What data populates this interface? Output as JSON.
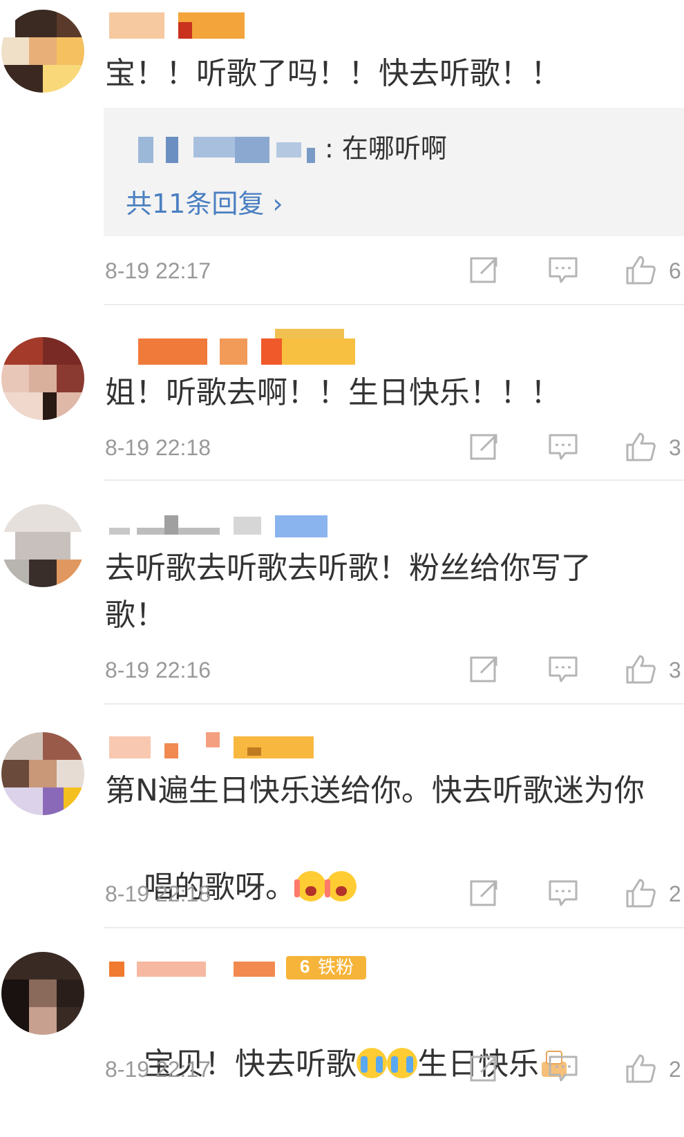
{
  "comments": [
    {
      "text": "宝！！听歌了吗！！快去听歌！！",
      "time": "8-19 22:17",
      "likes": "6",
      "reply": {
        "text": ": 在哪听啊",
        "count_label": "共11条回复 ›"
      }
    },
    {
      "text": "姐！听歌去啊！！生日快乐！！！",
      "time": "8-19 22:18",
      "likes": "3"
    },
    {
      "text_line1": "去听歌去听歌去听歌！粉丝给你写了",
      "text_line2": "歌！",
      "time": "8-19 22:16",
      "likes": "3"
    },
    {
      "text_line1": "第N遍生日快乐送给你。快去听歌迷为你",
      "text_line2": "唱的歌呀。",
      "time": "8-19 22:18",
      "likes": "2"
    },
    {
      "text_a": "宝贝！快去听歌",
      "text_b": "生日快乐",
      "badge": "铁粉",
      "badge_level": "6",
      "time": "8-19 22:17",
      "likes": "2"
    }
  ],
  "icons": {
    "share": "share-icon",
    "comment": "comment-icon",
    "like": "like-icon",
    "emoji_cry": "crying-emoji",
    "emoji_angry": "screaming-emoji",
    "emoji_cake": "birthday-cake-emoji"
  },
  "colors": {
    "link": "#4a7fc1",
    "meta": "#999999",
    "text": "#333333",
    "reply_bg": "#f3f3f3"
  }
}
